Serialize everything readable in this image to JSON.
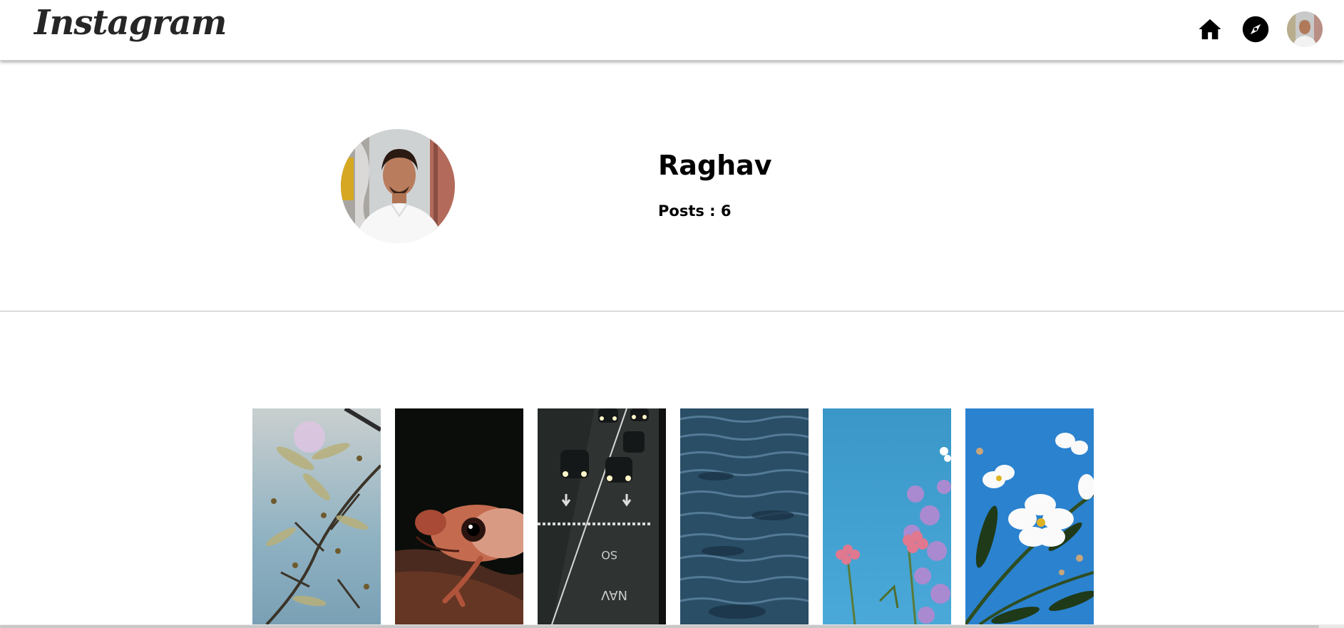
{
  "navbar": {
    "brand": "Instagram",
    "icons": [
      "home-icon",
      "compass-icon",
      "profile-avatar"
    ]
  },
  "profile": {
    "name": "Raghav",
    "posts_label": "Posts : 6"
  },
  "posts": [
    {
      "subject": "branches against sky"
    },
    {
      "subject": "red frog"
    },
    {
      "subject": "night highway cars"
    },
    {
      "subject": "ocean water"
    },
    {
      "subject": "pink and purple flowers"
    },
    {
      "subject": "white flowers blue sky"
    }
  ],
  "colors": {
    "brand": "#262626",
    "divider": "#bdbdbd",
    "background": "#ffffff"
  }
}
